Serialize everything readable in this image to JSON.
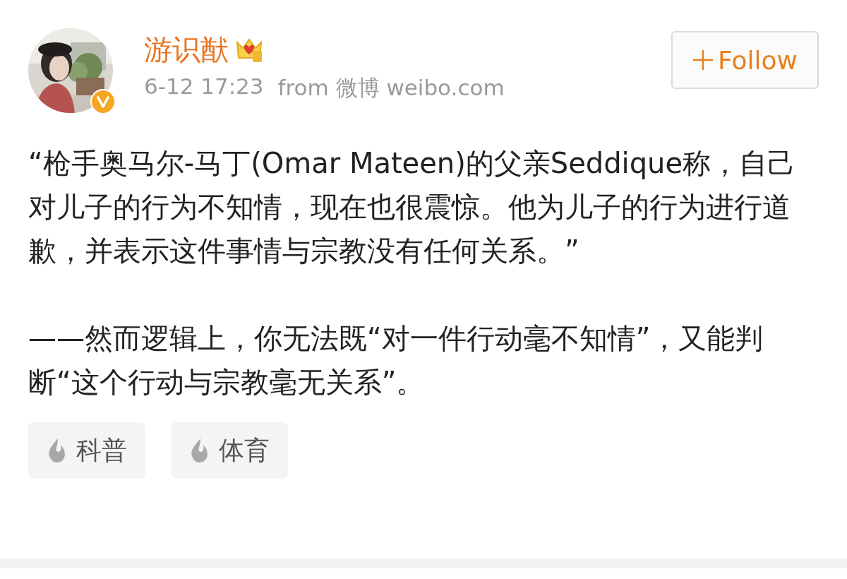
{
  "post": {
    "author": {
      "name": "游识猷"
    },
    "time": "6-12 17:23",
    "source": "from 微博 weibo.com",
    "follow_button": {
      "label": "Follow"
    },
    "paragraphs": [
      "“枪手奥马尔-马丁(Omar Mateen)的父亲Seddique称，自己对儿子的行为不知情，现在也很震惊。他为儿子的行为进行道歉，并表示这件事情与宗教没有任何关系。”",
      "——然而逻辑上，你无法既“对一件行动毫不知情”，又能判断“这个行动与宗教毫无关系”。"
    ],
    "topics": [
      {
        "label": "科普"
      },
      {
        "label": "体育"
      }
    ]
  }
}
